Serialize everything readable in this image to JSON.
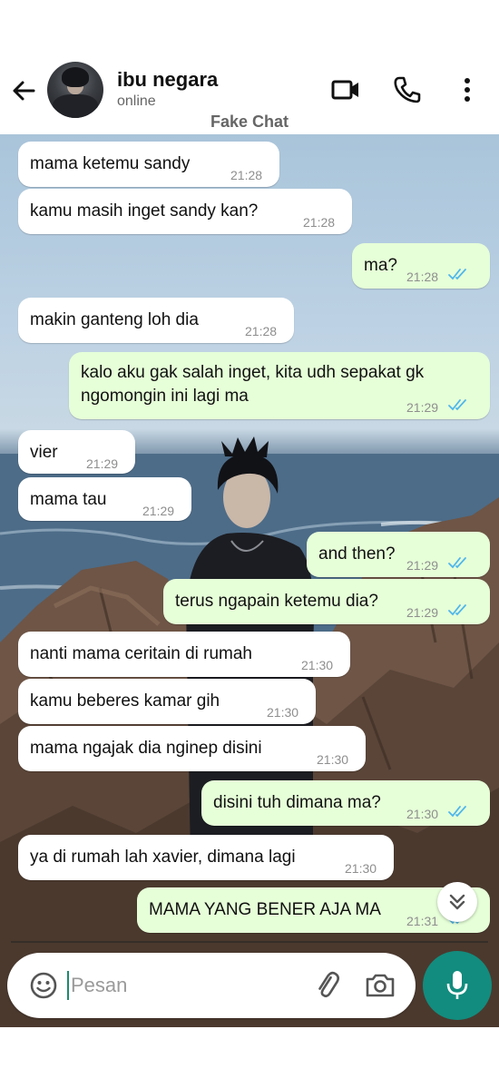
{
  "header": {
    "contact_name": "ibu negara",
    "status": "online",
    "overlay_label": "Fake Chat",
    "icons": [
      "back-arrow-icon",
      "video-call-icon",
      "phone-icon",
      "more-vert-icon"
    ]
  },
  "messages": [
    {
      "dir": "in",
      "text": "mama ketemu sandy",
      "time": "21:28"
    },
    {
      "dir": "in",
      "text": "kamu masih inget sandy kan?",
      "time": "21:28"
    },
    {
      "dir": "out",
      "text": "ma?",
      "time": "21:28",
      "status": "read"
    },
    {
      "dir": "in",
      "text": "makin ganteng loh dia",
      "time": "21:28"
    },
    {
      "dir": "out",
      "text": "kalo aku gak salah inget, kita udh sepakat gk\nngomongin ini lagi ma",
      "time": "21:29",
      "status": "read"
    },
    {
      "dir": "in",
      "text": "vier",
      "time": "21:29"
    },
    {
      "dir": "in",
      "text": "mama tau",
      "time": "21:29"
    },
    {
      "dir": "out",
      "text": "and then?",
      "time": "21:29",
      "status": "read"
    },
    {
      "dir": "out",
      "text": "terus ngapain ketemu dia?",
      "time": "21:29",
      "status": "read"
    },
    {
      "dir": "in",
      "text": "nanti mama ceritain di rumah",
      "time": "21:30"
    },
    {
      "dir": "in",
      "text": "kamu beberes kamar gih",
      "time": "21:30"
    },
    {
      "dir": "in",
      "text": "mama ngajak dia nginep disini",
      "time": "21:30"
    },
    {
      "dir": "out",
      "text": "disini tuh dimana ma?",
      "time": "21:30",
      "status": "read"
    },
    {
      "dir": "in",
      "text": "ya di rumah lah xavier, dimana lagi",
      "time": "21:30"
    },
    {
      "dir": "out",
      "text": "MAMA YANG BENER AJA MA",
      "time": "21:31",
      "status": "read"
    }
  ],
  "composer": {
    "placeholder": "Pesan",
    "value": "",
    "icons": [
      "emoji-icon",
      "attach-icon",
      "camera-icon",
      "mic-icon"
    ]
  },
  "colors": {
    "incoming_bubble": "#ffffff",
    "outgoing_bubble": "#e6ffd8",
    "read_ticks": "#4fb6ec",
    "mic_button": "#128c7e"
  }
}
